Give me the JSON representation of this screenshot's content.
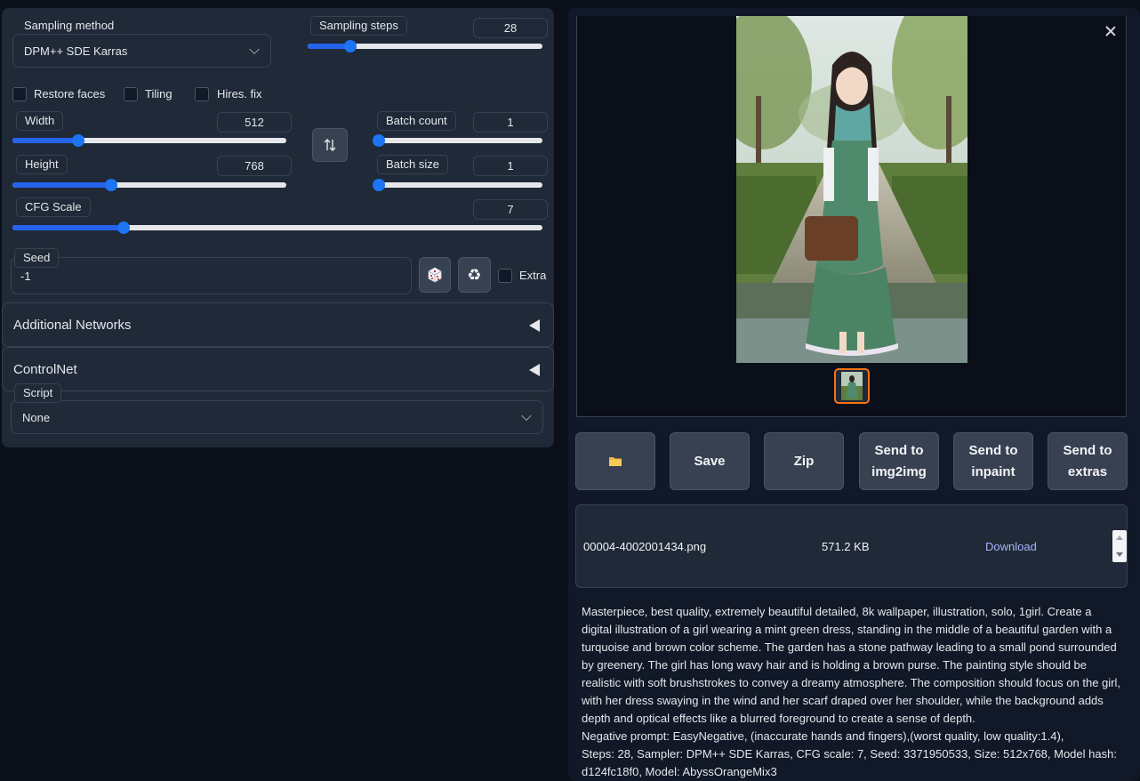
{
  "sampling": {
    "method_label": "Sampling method",
    "method_value": "DPM++ SDE Karras",
    "steps_label": "Sampling steps",
    "steps_value": "28",
    "steps_fraction": 0.18
  },
  "options": {
    "restore_faces": "Restore faces",
    "tiling": "Tiling",
    "hires_fix": "Hires. fix"
  },
  "size": {
    "width_label": "Width",
    "width_value": "512",
    "width_fraction": 0.24,
    "height_label": "Height",
    "height_value": "768",
    "height_fraction": 0.36,
    "swap_icon": "swap-vertical-icon"
  },
  "batch": {
    "count_label": "Batch count",
    "count_value": "1",
    "count_fraction": 0.0,
    "size_label": "Batch size",
    "size_value": "1",
    "size_fraction": 0.0
  },
  "cfg": {
    "label": "CFG Scale",
    "value": "7",
    "fraction": 0.21
  },
  "seed": {
    "label": "Seed",
    "value": "-1",
    "dice_icon": "dice-icon",
    "recycle_icon": "recycle-icon",
    "extra_label": "Extra"
  },
  "accordions": {
    "additional_networks": "Additional Networks",
    "controlnet": "ControlNet"
  },
  "script": {
    "label": "Script",
    "value": "None"
  },
  "actions": {
    "folder_icon": "folder-icon",
    "save": "Save",
    "zip": "Zip",
    "send_img2img": "Send to img2img",
    "send_inpaint": "Send to inpaint",
    "send_extras": "Send to extras"
  },
  "file": {
    "name": "00004-4002001434.png",
    "size": "571.2 KB",
    "download": "Download"
  },
  "generation_info": "Masterpiece, best quality, extremely beautiful detailed, 8k wallpaper, illustration, solo, 1girl. Create a digital illustration of a girl wearing a mint green dress, standing in the middle of a beautiful garden with a turquoise and brown color scheme. The garden has a stone pathway leading to a small pond surrounded by greenery. The girl has long wavy hair and is holding a brown purse. The painting style should be realistic with soft brushstrokes to convey a dreamy atmosphere. The composition should focus on the girl, with her dress swaying in the wind and her scarf draped over her shoulder, while the background adds depth and optical effects like a blurred foreground to create a sense of depth.\nNegative prompt: EasyNegative, (inaccurate hands and fingers),(worst quality, low quality:1.4),\nSteps: 28, Sampler: DPM++ SDE Karras, CFG scale: 7, Seed: 3371950533, Size: 512x768, Model hash: d124fc18f0, Model: AbyssOrangeMix3",
  "colors": {
    "accent": "#1d74f5",
    "panel": "#1f2937",
    "background": "#0b0f19",
    "thumb_border": "#f97316"
  }
}
